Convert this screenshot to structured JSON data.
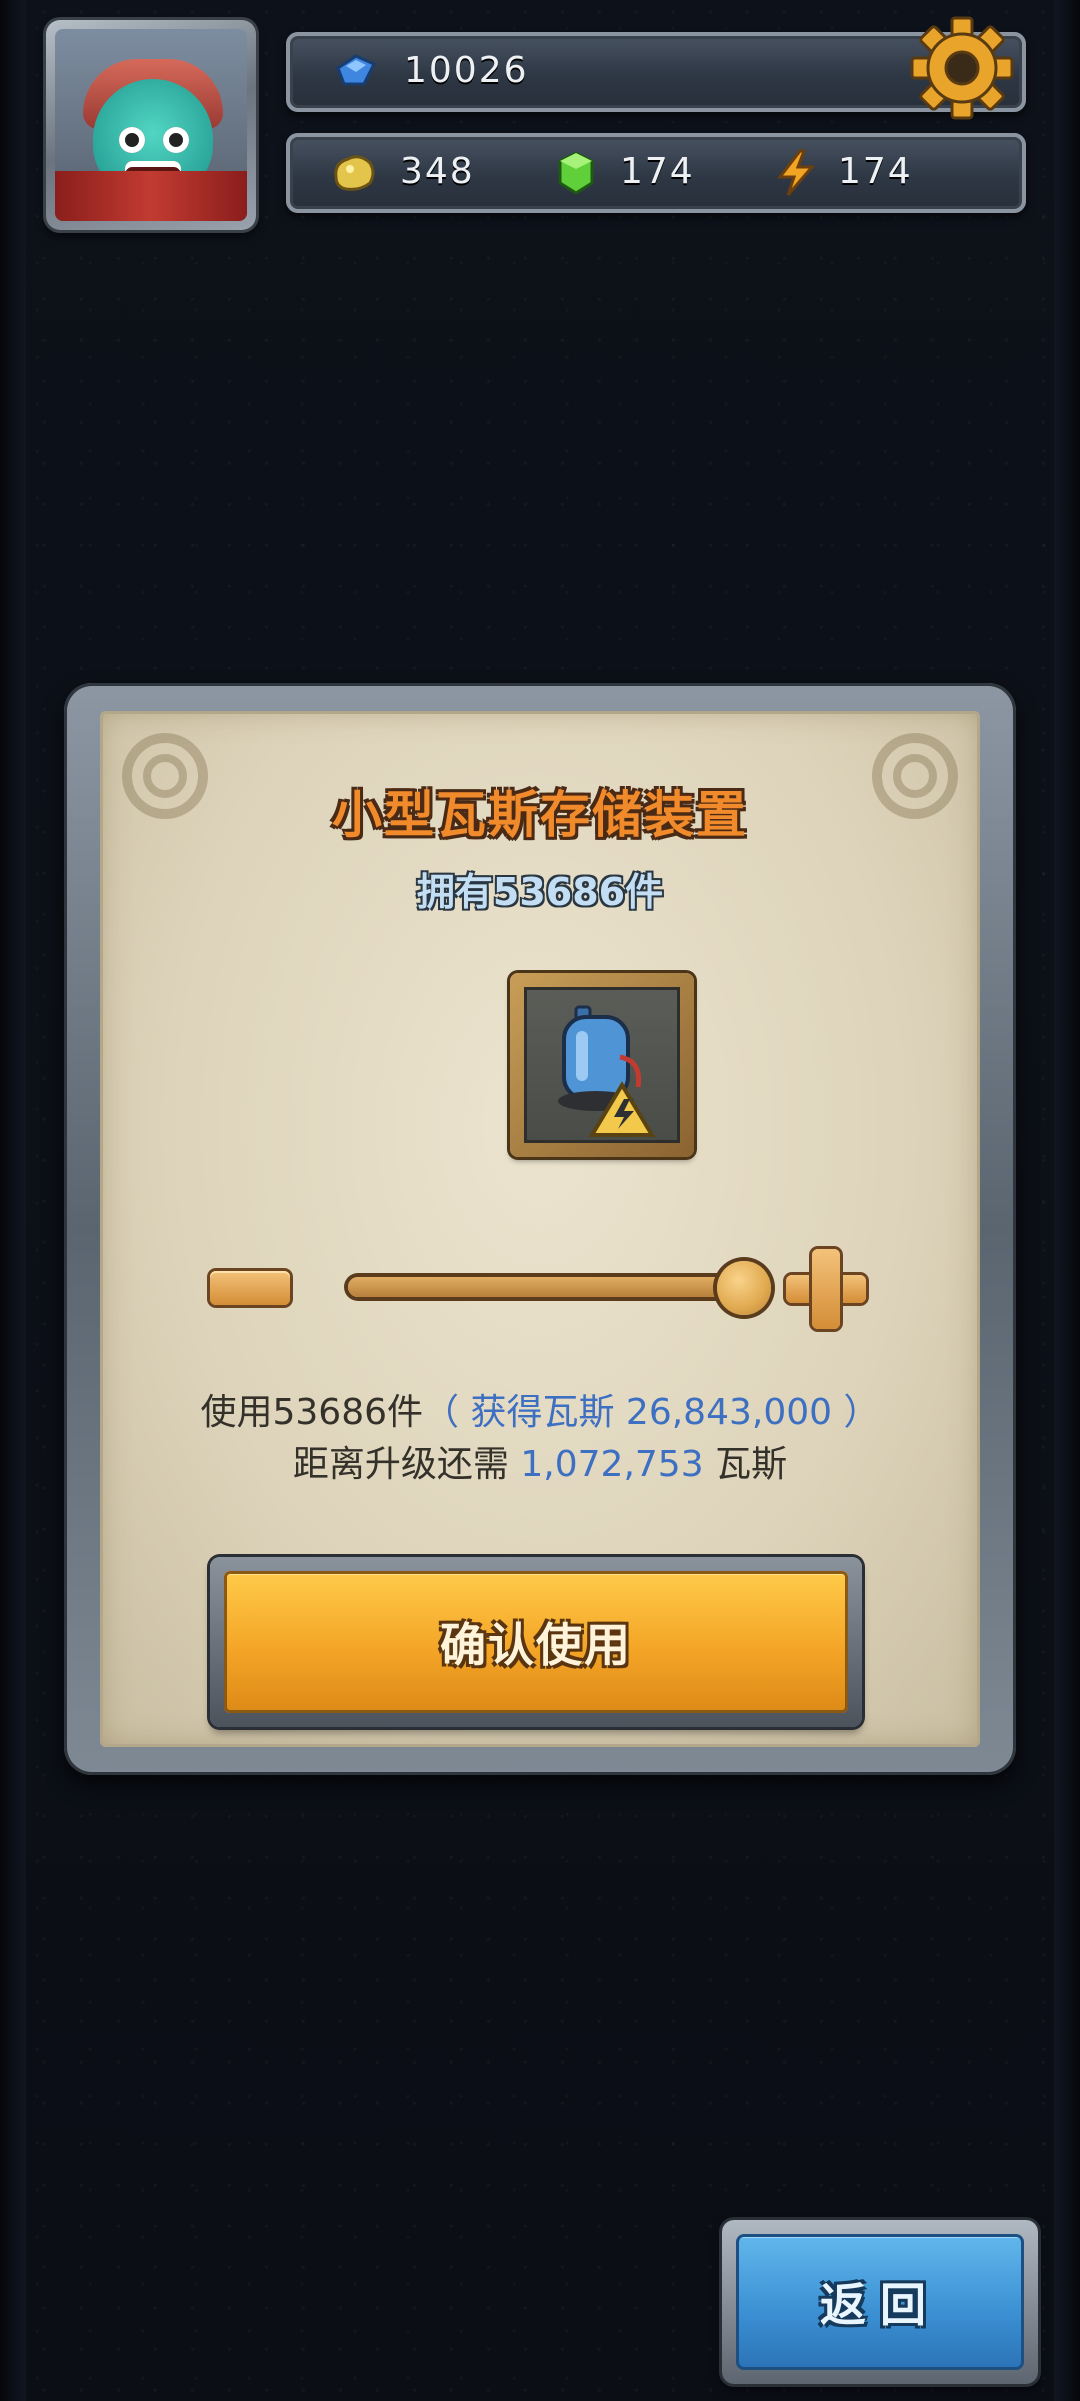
{
  "hud": {
    "diamonds": "10026",
    "gold": "348",
    "crystal": "174",
    "energy": "174"
  },
  "dialog": {
    "title": "小型瓦斯存储装置",
    "owned": "拥有53686件",
    "item_icon": "gas-tank-icon",
    "slider_fraction": 1.0,
    "use_prefix": "使用53686件",
    "gain_text": "（ 获得瓦斯 26,843,000 ）",
    "upgrade_prefix": "距离升级还需",
    "upgrade_amount": "1,072,753",
    "upgrade_unit": "瓦斯",
    "confirm_label": "确认使用"
  },
  "back_label": "返回",
  "colors": {
    "title": "#f08a2b",
    "owned": "#c3def2",
    "info_blue": "#3d6fc2",
    "confirm": "#f4a526",
    "back": "#3a8fd2"
  }
}
